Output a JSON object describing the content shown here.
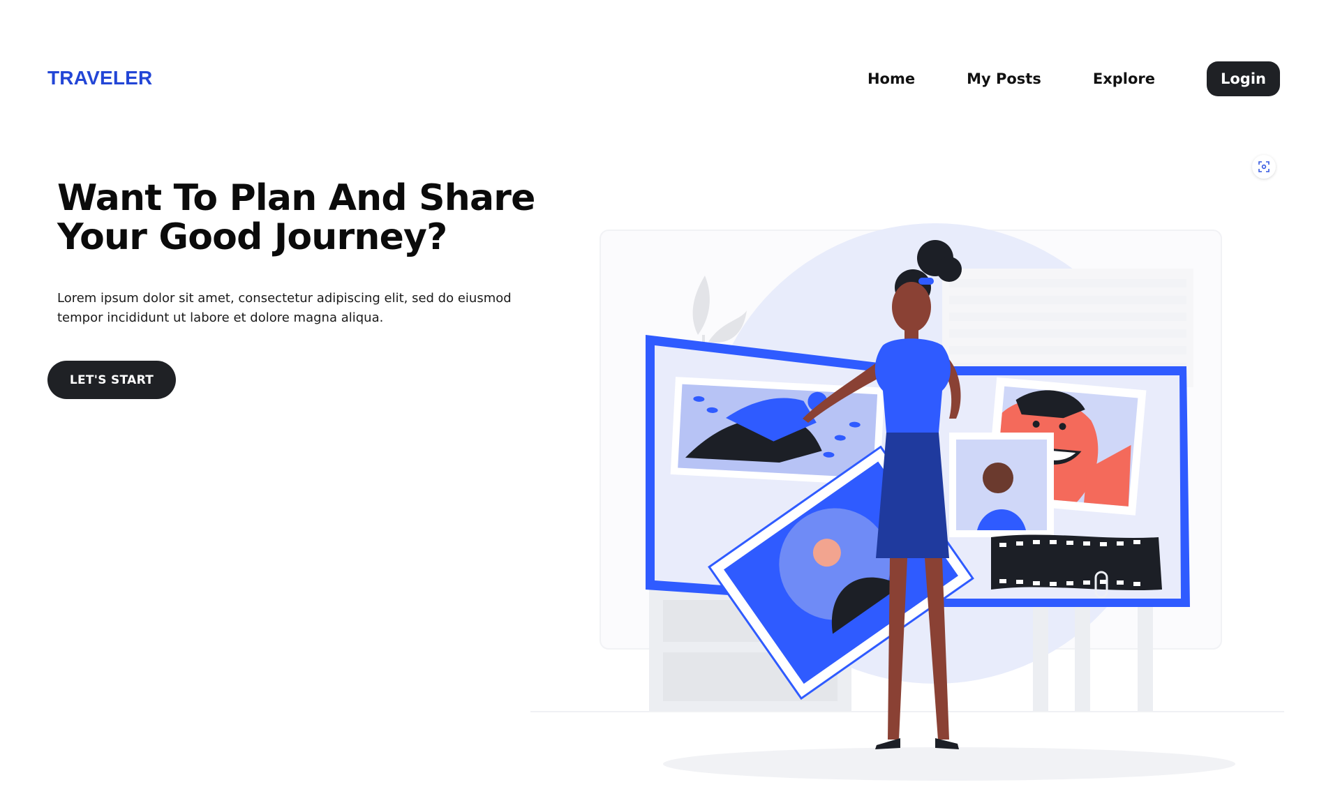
{
  "brand": {
    "name": "TRAVELER",
    "color": "#2346d6"
  },
  "nav": {
    "links": [
      "Home",
      "My Posts",
      "Explore"
    ],
    "login_label": "Login"
  },
  "hero": {
    "title_line1": "Want To Plan And Share",
    "title_line2": "Your Good Journey?",
    "description_line1": "Lorem ipsum dolor sit amet, consectetur adipiscing elit, sed do eiusmod",
    "description_line2": "tempor incididunt ut labore et dolore magna aliqua.",
    "cta_label": "LET'S START"
  },
  "icons": {
    "image_search": "scan-icon",
    "illustration": "travel-photo-board-illustration"
  },
  "colors": {
    "accent_blue": "#2f5bff",
    "dark": "#1f2125",
    "light_blue": "#e8ecfb"
  }
}
